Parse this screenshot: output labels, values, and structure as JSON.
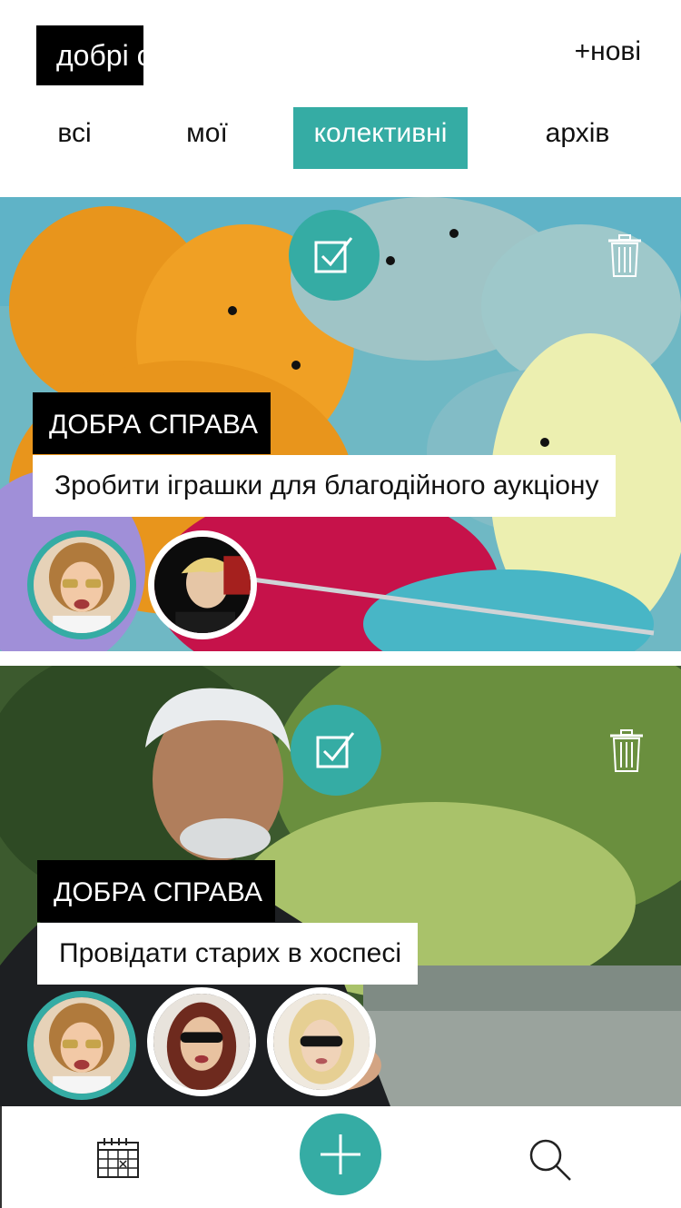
{
  "header": {
    "logo_text": "добрі справи",
    "new_label": "+нові"
  },
  "tabs": [
    {
      "label": "всі",
      "active": false
    },
    {
      "label": "мої",
      "active": false
    },
    {
      "label": "колективні",
      "active": true
    },
    {
      "label": "архів",
      "active": false
    }
  ],
  "cards": [
    {
      "type_label": "ДОБРА СПРАВА",
      "title": "Зробити іграшки для благодійного аукціону",
      "background": "knitted-toys-photo",
      "participants": 2
    },
    {
      "type_label": "ДОБРА СПРАВА",
      "title": "Провідати старих в хоспесі",
      "background": "elderly-man-photo",
      "participants": 3
    }
  ],
  "icons": {
    "check": "checkbox-icon",
    "trash": "trash-icon",
    "calendar": "calendar-icon",
    "add": "plus-icon",
    "search": "search-icon"
  },
  "colors": {
    "accent": "#35aca4",
    "label_bg": "#000000",
    "title_bg": "#ffffff"
  }
}
